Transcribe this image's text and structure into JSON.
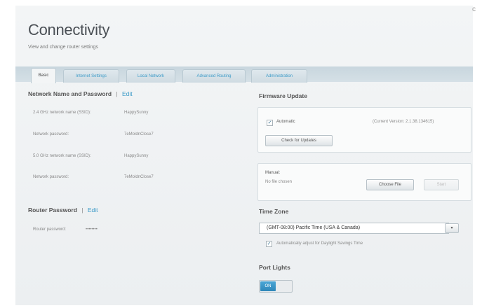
{
  "window": {
    "close_glyph": "c"
  },
  "header": {
    "title": "Connectivity",
    "subtitle": "View and change router settings"
  },
  "tabs": [
    {
      "label": "Basic"
    },
    {
      "label": "Internet Settings"
    },
    {
      "label": "Local Network"
    },
    {
      "label": "Advanced Routing"
    },
    {
      "label": "Administration"
    }
  ],
  "network": {
    "heading": "Network Name and Password",
    "separator": "|",
    "edit_label": "Edit",
    "rows": [
      {
        "label": "2.4 GHz network name (SSID):",
        "value": "HappySunny"
      },
      {
        "label": "Network password:",
        "value": "7eMoldnClose7"
      },
      {
        "label": "5.0 GHz network name (SSID):",
        "value": "HappySunny"
      },
      {
        "label": "Network password:",
        "value": "7eMoldnClose7"
      }
    ]
  },
  "router_password": {
    "heading": "Router Password",
    "separator": "|",
    "edit_label": "Edit",
    "label": "Router password:",
    "value": "••••••••"
  },
  "firmware": {
    "heading": "Firmware Update",
    "automatic_label": "Automatic",
    "automatic_checked": true,
    "current_version": "(Current Version: 2.1.38.134615)",
    "check_button": "Check for Updates",
    "manual_label": "Manual:",
    "file_status": "No file chosen",
    "choose_button": "Choose File",
    "start_button": "Start"
  },
  "timezone": {
    "heading": "Time Zone",
    "selected": "(GMT-08:00) Pacific Time (USA & Canada)",
    "dst_label": "Automatically adjust for Daylight Savings Time",
    "dst_checked": true
  },
  "port_lights": {
    "heading": "Port Lights",
    "state_label": "ON"
  },
  "colors": {
    "accent": "#3d9bc8",
    "toggle_on": "#2e86b8"
  }
}
